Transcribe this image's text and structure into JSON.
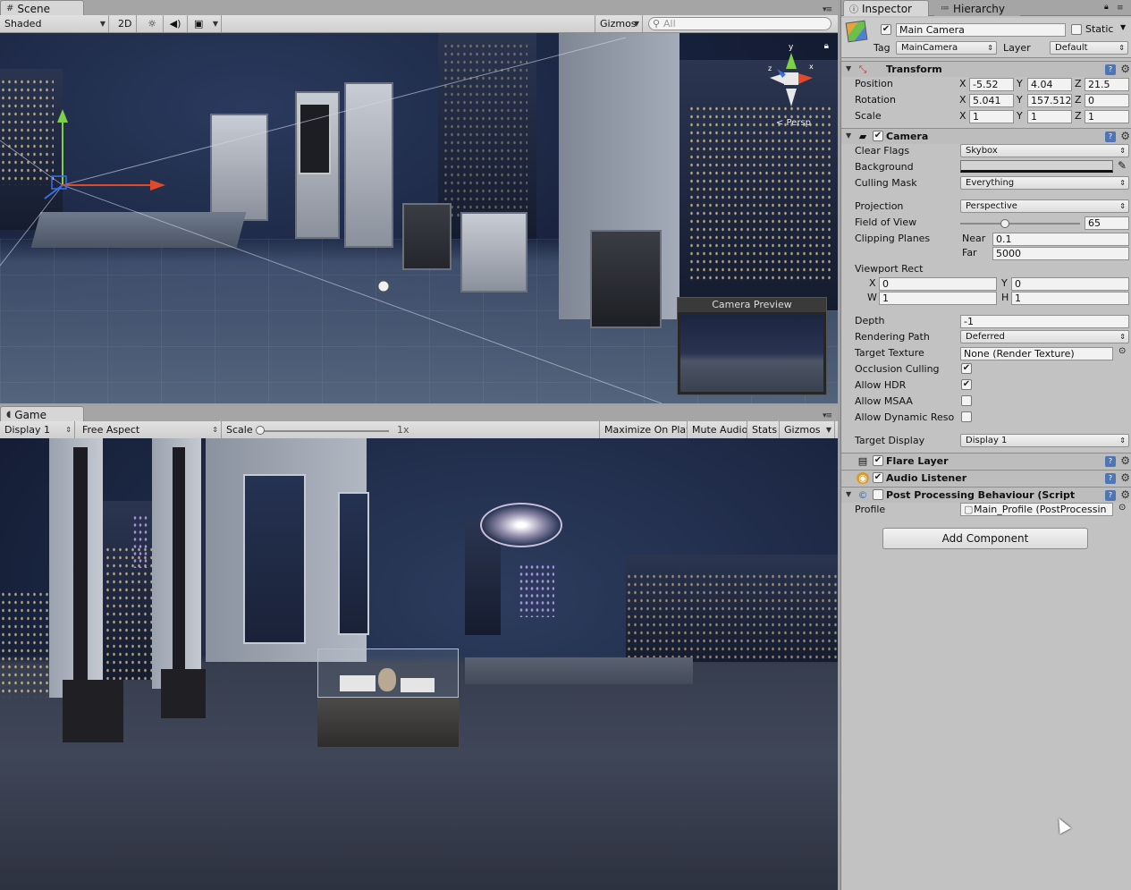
{
  "scene": {
    "tab_label": "Scene",
    "shading_mode": "Shaded",
    "mode_2d": "2D",
    "gizmos": "Gizmos",
    "search_placeholder": "All",
    "persp_label": "Persp",
    "camera_preview_title": "Camera Preview"
  },
  "game": {
    "tab_label": "Game",
    "display": "Display 1",
    "aspect": "Free Aspect",
    "scale_label": "Scale",
    "scale_value": "1x",
    "maximize_on_play": "Maximize On Play",
    "mute_audio": "Mute Audio",
    "stats": "Stats",
    "gizmos": "Gizmos"
  },
  "inspector": {
    "tab_label": "Inspector",
    "hierarchy_tab_label": "Hierarchy",
    "object_name": "Main Camera",
    "static_label": "Static",
    "tag_label": "Tag",
    "tag_value": "MainCamera",
    "layer_label": "Layer",
    "layer_value": "Default",
    "transform": {
      "title": "Transform",
      "position_label": "Position",
      "rotation_label": "Rotation",
      "scale_label": "Scale",
      "axis_x": "X",
      "axis_y": "Y",
      "axis_z": "Z",
      "position": {
        "x": "-5.52",
        "y": "4.04",
        "z": "21.5"
      },
      "rotation": {
        "x": "5.041",
        "y": "157.512",
        "z": "0"
      },
      "scale": {
        "x": "1",
        "y": "1",
        "z": "1"
      }
    },
    "camera": {
      "title": "Camera",
      "clear_flags_label": "Clear Flags",
      "clear_flags": "Skybox",
      "background_label": "Background",
      "culling_mask_label": "Culling Mask",
      "culling_mask": "Everything",
      "projection_label": "Projection",
      "projection": "Perspective",
      "fov_label": "Field of View",
      "fov": "65",
      "fov_fraction": 0.37,
      "clipping_label": "Clipping Planes",
      "near_label": "Near",
      "near": "0.1",
      "far_label": "Far",
      "far": "5000",
      "viewport_label": "Viewport Rect",
      "vx_label": "X",
      "vx": "0",
      "vy_label": "Y",
      "vy": "0",
      "vw_label": "W",
      "vw": "1",
      "vh_label": "H",
      "vh": "1",
      "depth_label": "Depth",
      "depth": "-1",
      "rendering_path_label": "Rendering Path",
      "rendering_path": "Deferred",
      "target_texture_label": "Target Texture",
      "target_texture": "None (Render Texture)",
      "occlusion_label": "Occlusion Culling",
      "hdr_label": "Allow HDR",
      "msaa_label": "Allow MSAA",
      "dynamic_label": "Allow Dynamic Reso",
      "target_display_label": "Target Display",
      "target_display": "Display 1"
    },
    "flare_layer": "Flare Layer",
    "audio_listener": "Audio Listener",
    "post_processing": {
      "title": "Post Processing Behaviour (Script",
      "profile_label": "Profile",
      "profile_value": "Main_Profile (PostProcessin"
    },
    "add_component": "Add Component"
  },
  "colors": {
    "help_icon": "#4f75b5",
    "inspector_bg": "#c2c2c2"
  }
}
